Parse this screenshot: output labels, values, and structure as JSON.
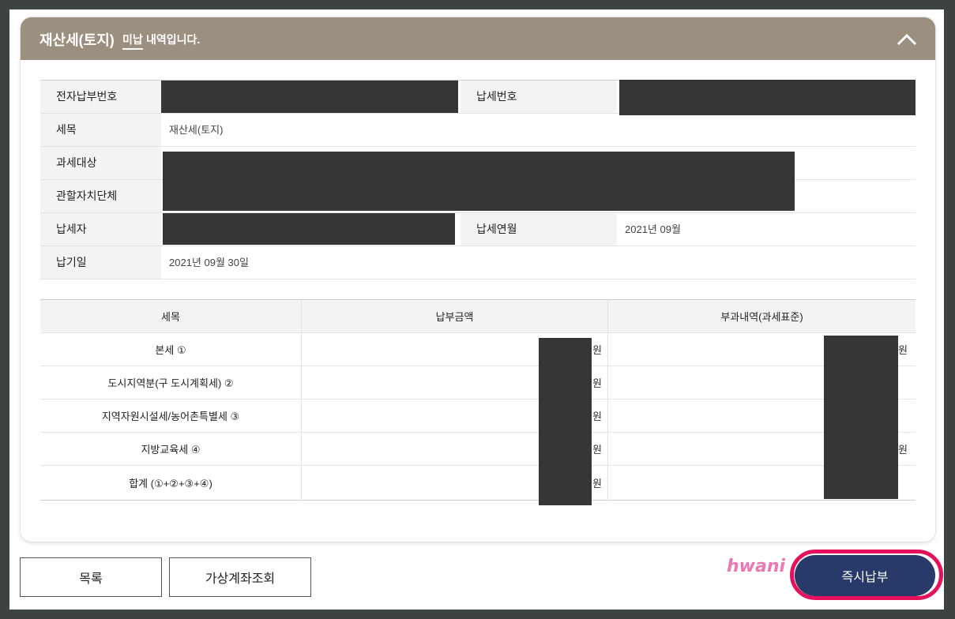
{
  "header": {
    "title": "재산세(토지)",
    "status": "미납",
    "status_suffix": "내역입니다."
  },
  "info": {
    "e_payment_no_label": "전자납부번호",
    "tax_no_label": "납세번호",
    "tax_item_label": "세목",
    "tax_item_value": "재산세(토지)",
    "tax_object_label": "과세대상",
    "jurisdiction_label": "관할자치단체",
    "taxpayer_label": "납세자",
    "tax_month_label": "납세연월",
    "tax_month_value": "2021년 09월",
    "due_date_label": "납기일",
    "due_date_value": "2021년 09월 30일"
  },
  "amount_table": {
    "headers": [
      "세목",
      "납부금액",
      "부과내역(과세표준)"
    ],
    "rows": [
      {
        "name": "본세 ①",
        "unit2": "원",
        "unit3": "원"
      },
      {
        "name": "도시지역분(구 도시계획세) ②",
        "unit2": "원",
        "unit3": ""
      },
      {
        "name": "지역자원시설세/농어촌특별세 ③",
        "unit2": "원",
        "unit3": ""
      },
      {
        "name": "지방교육세 ④",
        "unit2": "원",
        "unit3": "원"
      },
      {
        "name": "합계 (①+②+③+④)",
        "unit2": "원",
        "unit3": ""
      }
    ]
  },
  "buttons": {
    "list": "목록",
    "virtual_account": "가상계좌조회",
    "pay_now": "즉시납부"
  },
  "watermark": "hwani",
  "colors": {
    "header_bg": "#9b9080",
    "pay_button": "#283a6a",
    "highlight": "#e5115d",
    "redaction": "#363636"
  }
}
